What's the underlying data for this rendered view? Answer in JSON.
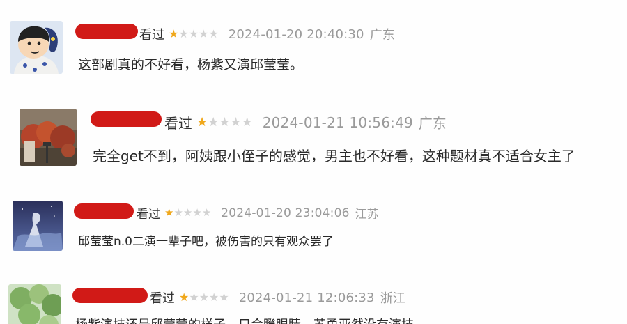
{
  "reviews": [
    {
      "watched_label": "看过",
      "rating": 1,
      "max_rating": 5,
      "time": "2024-01-20 20:40:30",
      "location": "广东",
      "content": "这部剧真的不好看，杨紫又演邱莹莹。"
    },
    {
      "watched_label": "看过",
      "rating": 1,
      "max_rating": 5,
      "time": "2024-01-21 10:56:49",
      "location": "广东",
      "content": "完全get不到，阿姨跟小侄子的感觉，男主也不好看，这种题材真不适合女主了"
    },
    {
      "watched_label": "看过",
      "rating": 1,
      "max_rating": 5,
      "time": "2024-01-20 23:04:06",
      "location": "江苏",
      "content": "邱莹莹n.0二演一辈子吧，被伤害的只有观众罢了"
    },
    {
      "watched_label": "看过",
      "rating": 1,
      "max_rating": 5,
      "time": "2024-01-21 12:06:33",
      "location": "浙江",
      "content": "杨紫演技还是邱莹莹的样子，只会瞪眼睛，苏勇亚然没有演技"
    }
  ],
  "colors": {
    "star_on": "#f0a81c",
    "star_off": "#d2d2d2",
    "redaction": "#d11a17",
    "meta_text": "#9a9a9a"
  }
}
